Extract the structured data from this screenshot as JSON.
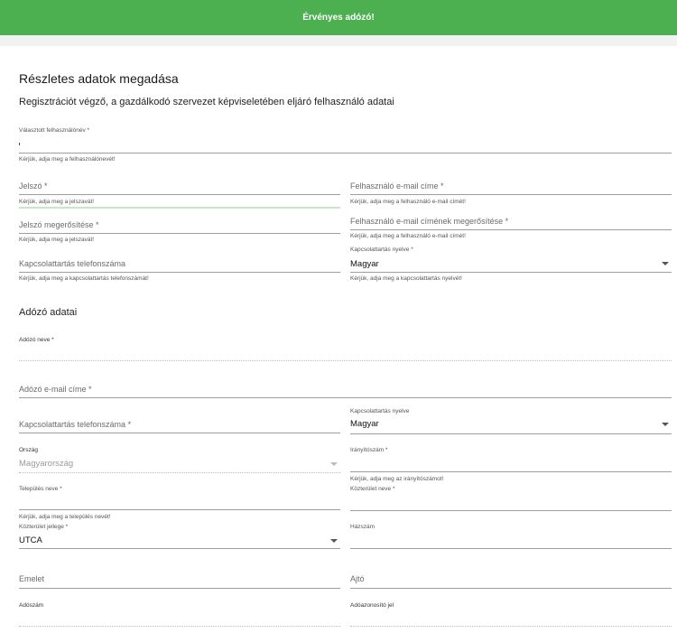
{
  "banner": {
    "text": "Érvényes adózó!"
  },
  "page": {
    "title": "Részletes adatok megadása",
    "subtitle": "Regisztrációt végző, a gazdálkodó szervezet képviseletében eljáró felhasználó adatai",
    "taxpayer_section_title": "Adózó adatai"
  },
  "user": {
    "username": {
      "label": "Választott felhasználónév *",
      "value": "",
      "help": "Kérjük, adja meg a felhasználónevét!"
    },
    "password": {
      "label": "Jelszó *",
      "value": "",
      "help": "Kérjük, adja meg a jelszavát!"
    },
    "email": {
      "label": "Felhasználó e-mail címe *",
      "value": "",
      "help": "Kérjük, adja meg a felhasználó e-mail címét!"
    },
    "password_confirm": {
      "label": "Jelszó megerősítése *",
      "value": "",
      "help": "Kérjük, adja meg a jelszavát!"
    },
    "email_confirm": {
      "label": "Felhasználó e-mail címének megerősítése *",
      "value": "",
      "help": "Kérjük, adja meg a felhasználó e-mail címét!"
    },
    "phone": {
      "label": "Kapcsolattartás telefonszáma",
      "value": "",
      "help": "Kérjük, adja meg a kapcsolattartás telefonszámát!"
    },
    "language": {
      "label": "Kapcsolattartás nyelve *",
      "value": "Magyar",
      "help": "Kérjük, adja meg a kapcsolattartás nyelvét!"
    }
  },
  "taxpayer": {
    "name": {
      "label": "Adózó neve *",
      "value": ""
    },
    "email": {
      "label": "Adózó e-mail címe *",
      "value": ""
    },
    "phone": {
      "label": "Kapcsolattartás telefonszáma *",
      "value": ""
    },
    "language": {
      "label": "Kapcsolattartás nyelve",
      "value": "Magyar"
    },
    "country": {
      "label": "Ország",
      "value": "Magyarország"
    },
    "zip": {
      "label": "Irányítószám *",
      "value": "",
      "help": "Kérjük, adja meg az irányítószámot!"
    },
    "city": {
      "label": "Település neve *",
      "value": "",
      "help": "Kérjük, adja meg a település nevét!"
    },
    "street_name": {
      "label": "Közterület neve *",
      "value": ""
    },
    "street_type": {
      "label": "Közterület jellege *",
      "value": "UTCA"
    },
    "house_number": {
      "label": "Házszám",
      "value": ""
    },
    "floor": {
      "label": "Emelet",
      "value": ""
    },
    "door": {
      "label": "Ajtó",
      "value": ""
    },
    "tax_number": {
      "label": "Adószám",
      "value": ""
    },
    "tax_id_mark": {
      "label": "Adóazonosító jel",
      "value": ""
    }
  }
}
